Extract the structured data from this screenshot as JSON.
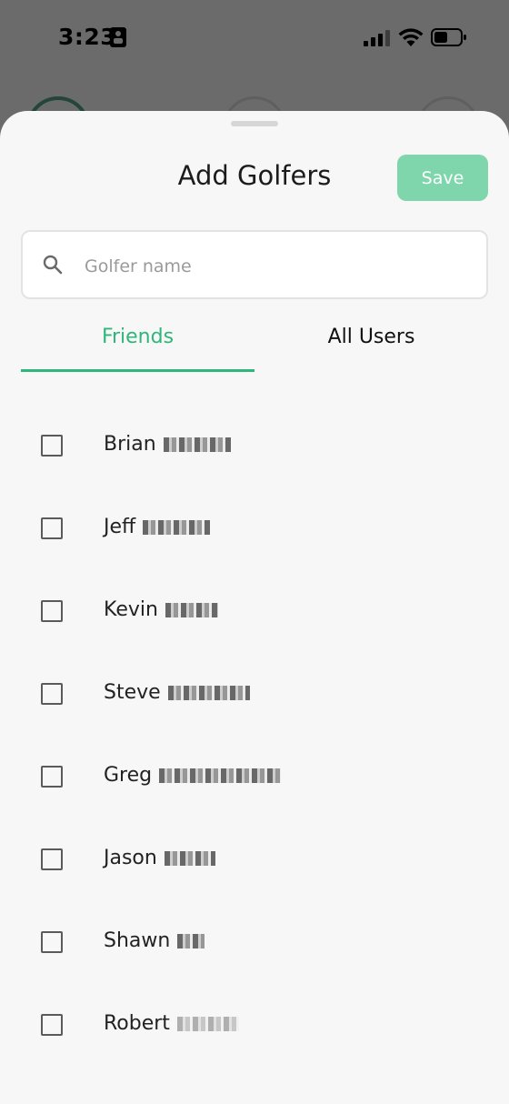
{
  "status_bar": {
    "time": "3:23"
  },
  "sheet": {
    "title": "Add Golfers",
    "save_label": "Save",
    "search": {
      "placeholder": "Golfer name",
      "value": ""
    },
    "tabs": [
      {
        "label": "Friends",
        "active": true
      },
      {
        "label": "All Users",
        "active": false
      }
    ],
    "golfers": [
      {
        "first_name": "Brian",
        "checked": false
      },
      {
        "first_name": "Jeff",
        "checked": false
      },
      {
        "first_name": "Kevin",
        "checked": false
      },
      {
        "first_name": "Steve",
        "checked": false
      },
      {
        "first_name": "Greg",
        "checked": false
      },
      {
        "first_name": "Jason",
        "checked": false
      },
      {
        "first_name": "Shawn",
        "checked": false
      },
      {
        "first_name": "Robert",
        "checked": false
      }
    ]
  },
  "colors": {
    "accent": "#2fb67a",
    "save_button": "#7fd6ad",
    "sheet_background": "#f7f7f7"
  }
}
